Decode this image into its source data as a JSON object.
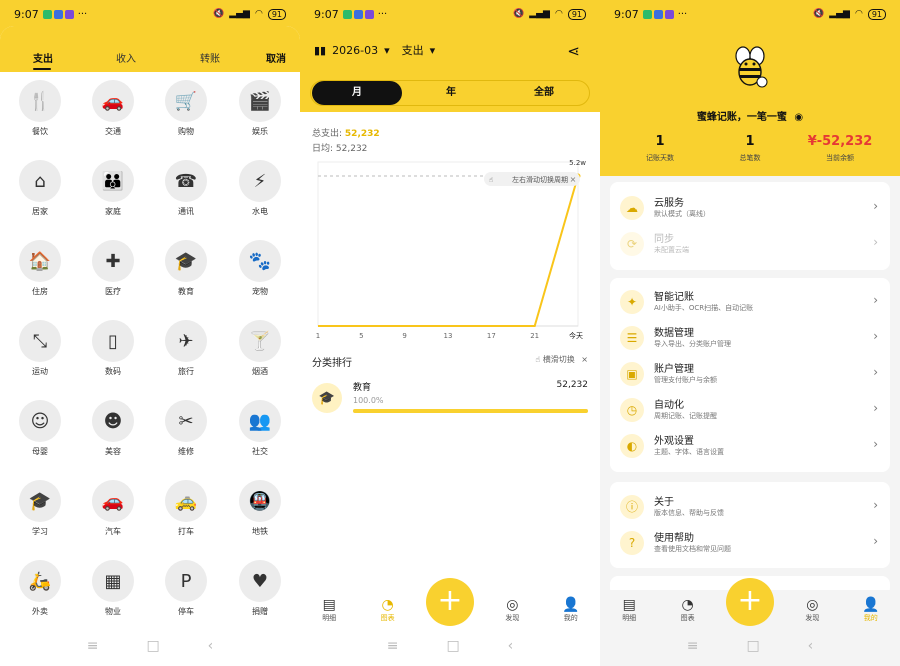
{
  "status": {
    "time": "9:07",
    "battery": "91"
  },
  "add": {
    "tabs": [
      "支出",
      "收入",
      "转账"
    ],
    "cancel": "取消",
    "categories": [
      {
        "label": "餐饮",
        "icon": "🍴"
      },
      {
        "label": "交通",
        "icon": "🚗"
      },
      {
        "label": "购物",
        "icon": "🛒"
      },
      {
        "label": "娱乐",
        "icon": "🎬"
      },
      {
        "label": "居家",
        "icon": "⌂"
      },
      {
        "label": "家庭",
        "icon": "👪"
      },
      {
        "label": "通讯",
        "icon": "☎"
      },
      {
        "label": "水电",
        "icon": "⚡"
      },
      {
        "label": "住房",
        "icon": "🏠"
      },
      {
        "label": "医疗",
        "icon": "✚"
      },
      {
        "label": "教育",
        "icon": "🎓"
      },
      {
        "label": "宠物",
        "icon": "🐾"
      },
      {
        "label": "运动",
        "icon": "⤡"
      },
      {
        "label": "数码",
        "icon": "▯"
      },
      {
        "label": "旅行",
        "icon": "✈"
      },
      {
        "label": "烟酒",
        "icon": "🍸"
      },
      {
        "label": "母婴",
        "icon": "☺"
      },
      {
        "label": "美容",
        "icon": "☻"
      },
      {
        "label": "维修",
        "icon": "✂"
      },
      {
        "label": "社交",
        "icon": "👥"
      },
      {
        "label": "学习",
        "icon": "🎓"
      },
      {
        "label": "汽车",
        "icon": "🚗"
      },
      {
        "label": "打车",
        "icon": "🚕"
      },
      {
        "label": "地铁",
        "icon": "🚇"
      },
      {
        "label": "外卖",
        "icon": "🛵"
      },
      {
        "label": "物业",
        "icon": "▦"
      },
      {
        "label": "停车",
        "icon": "P"
      },
      {
        "label": "捐赠",
        "icon": "♥"
      }
    ]
  },
  "stats": {
    "period": "2026-03",
    "type": "支出",
    "segments": [
      "月",
      "年",
      "全部"
    ],
    "total_label": "总支出:",
    "total_value": "52,232",
    "avg_label": "日均:",
    "avg_value": "52,232",
    "hint_swipe": "左右滑动切换周期",
    "max_label": "5.2w",
    "rank_title": "分类排行",
    "rank_hint": "横滑切换",
    "rank_item": {
      "name": "教育",
      "amount": "52,232",
      "percent": "100.0%",
      "fraction": 1.0
    }
  },
  "chart_data": {
    "type": "line",
    "x_tick_labels": [
      "1",
      "5",
      "9",
      "13",
      "17",
      "21",
      "今天"
    ],
    "max_label": "5.2w",
    "series": [
      {
        "values": [
          0,
          0,
          0,
          0,
          0,
          0,
          52232
        ]
      }
    ],
    "ylim": [
      0,
      52232
    ],
    "grid": false
  },
  "profile": {
    "slogan": "蜜蜂记账，一笔一蜜",
    "stats": [
      {
        "value": "1",
        "caption": "记账天数"
      },
      {
        "value": "1",
        "caption": "总笔数"
      },
      {
        "value": "¥-52,232",
        "caption": "当前余额"
      }
    ],
    "card1": [
      {
        "title": "云服务",
        "sub": "默认模式（离线）",
        "icon": "☁"
      },
      {
        "title": "同步",
        "sub": "未配置云端",
        "icon": "⟳"
      }
    ],
    "card2": [
      {
        "title": "智能记账",
        "sub": "AI小助手、OCR扫描、自动记账",
        "icon": "✦"
      },
      {
        "title": "数据管理",
        "sub": "导入导出、分类账户管理",
        "icon": "☰"
      },
      {
        "title": "账户管理",
        "sub": "管理支付账户与余额",
        "icon": "▣"
      },
      {
        "title": "自动化",
        "sub": "周期记账、记账提醒",
        "icon": "◷"
      },
      {
        "title": "外观设置",
        "sub": "主题、字体、语言设置",
        "icon": "◐"
      }
    ],
    "card3": [
      {
        "title": "关于",
        "sub": "版本信息、帮助与反馈",
        "icon": "ⓘ"
      },
      {
        "title": "使用帮助",
        "sub": "查看使用文档和常见问题",
        "icon": "?"
      }
    ]
  },
  "nav": [
    {
      "label": "明细",
      "icon": "▤"
    },
    {
      "label": "图表",
      "icon": "◔"
    },
    {
      "label": "发现",
      "icon": "◎"
    },
    {
      "label": "我的",
      "icon": "👤"
    }
  ]
}
